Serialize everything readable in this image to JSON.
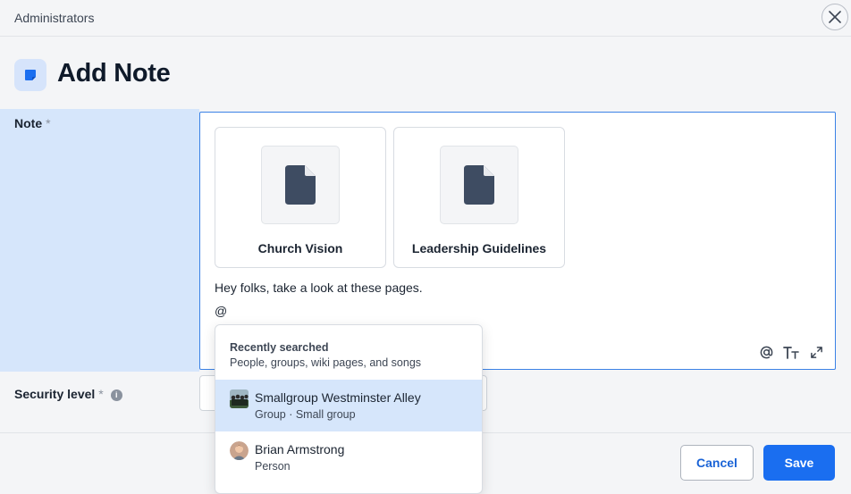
{
  "topbar": {
    "breadcrumb": "Administrators"
  },
  "header": {
    "title": "Add Note"
  },
  "note_field": {
    "label": "Note",
    "required_mark": "*",
    "attachments": [
      {
        "title": "Church Vision",
        "icon": "document-icon"
      },
      {
        "title": "Leadership Guidelines",
        "icon": "document-icon"
      }
    ],
    "body_line": "Hey folks, take a look at these pages.",
    "mention_line": "@",
    "toolbar": [
      "mention-icon",
      "text-format-icon",
      "expand-icon"
    ]
  },
  "security_field": {
    "label": "Security level",
    "required_mark": "*",
    "info": "i"
  },
  "mention_dropdown": {
    "heading": "Recently searched",
    "subheading": "People, groups, wiki pages, and songs",
    "items": [
      {
        "name": "Smallgroup Westminster Alley",
        "sub": "Group · Small group",
        "active": true
      },
      {
        "name": "Brian Armstrong",
        "sub": "Person",
        "active": false
      }
    ]
  },
  "footer": {
    "cancel_label": "Cancel",
    "save_label": "Save"
  },
  "colors": {
    "accent": "#1a6ef0",
    "highlight": "#d6e6fb",
    "cancel_text": "#1a63d6"
  }
}
